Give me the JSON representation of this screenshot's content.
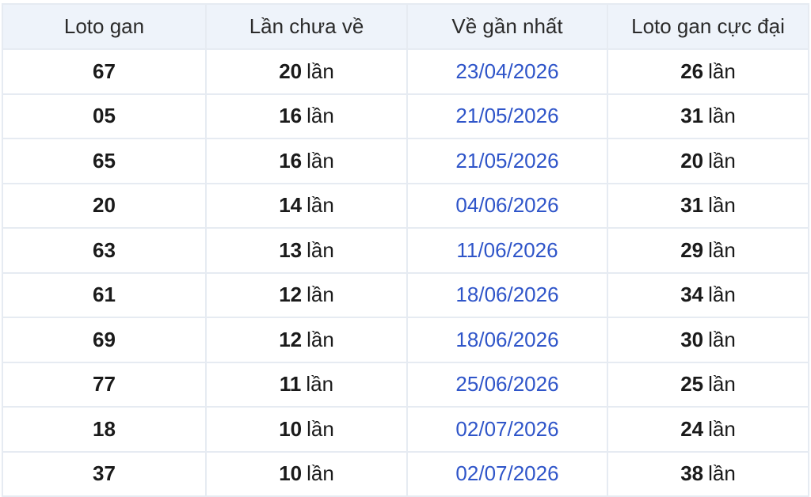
{
  "table": {
    "headers": [
      "Loto gan",
      "Lần chưa về",
      "Về gần nhất",
      "Loto gan cực đại"
    ],
    "unit": "lần",
    "rows": [
      {
        "loto": "67",
        "missed": "20",
        "last": "23/04/2026",
        "max": "26"
      },
      {
        "loto": "05",
        "missed": "16",
        "last": "21/05/2026",
        "max": "31"
      },
      {
        "loto": "65",
        "missed": "16",
        "last": "21/05/2026",
        "max": "20"
      },
      {
        "loto": "20",
        "missed": "14",
        "last": "04/06/2026",
        "max": "31"
      },
      {
        "loto": "63",
        "missed": "13",
        "last": "11/06/2026",
        "max": "29"
      },
      {
        "loto": "61",
        "missed": "12",
        "last": "18/06/2026",
        "max": "34"
      },
      {
        "loto": "69",
        "missed": "12",
        "last": "18/06/2026",
        "max": "30"
      },
      {
        "loto": "77",
        "missed": "11",
        "last": "25/06/2026",
        "max": "25"
      },
      {
        "loto": "18",
        "missed": "10",
        "last": "02/07/2026",
        "max": "24"
      },
      {
        "loto": "37",
        "missed": "10",
        "last": "02/07/2026",
        "max": "38"
      }
    ]
  },
  "colors": {
    "header_bg": "#eef3fa",
    "border": "#e6ebf2",
    "date_text": "#2f55c9"
  }
}
